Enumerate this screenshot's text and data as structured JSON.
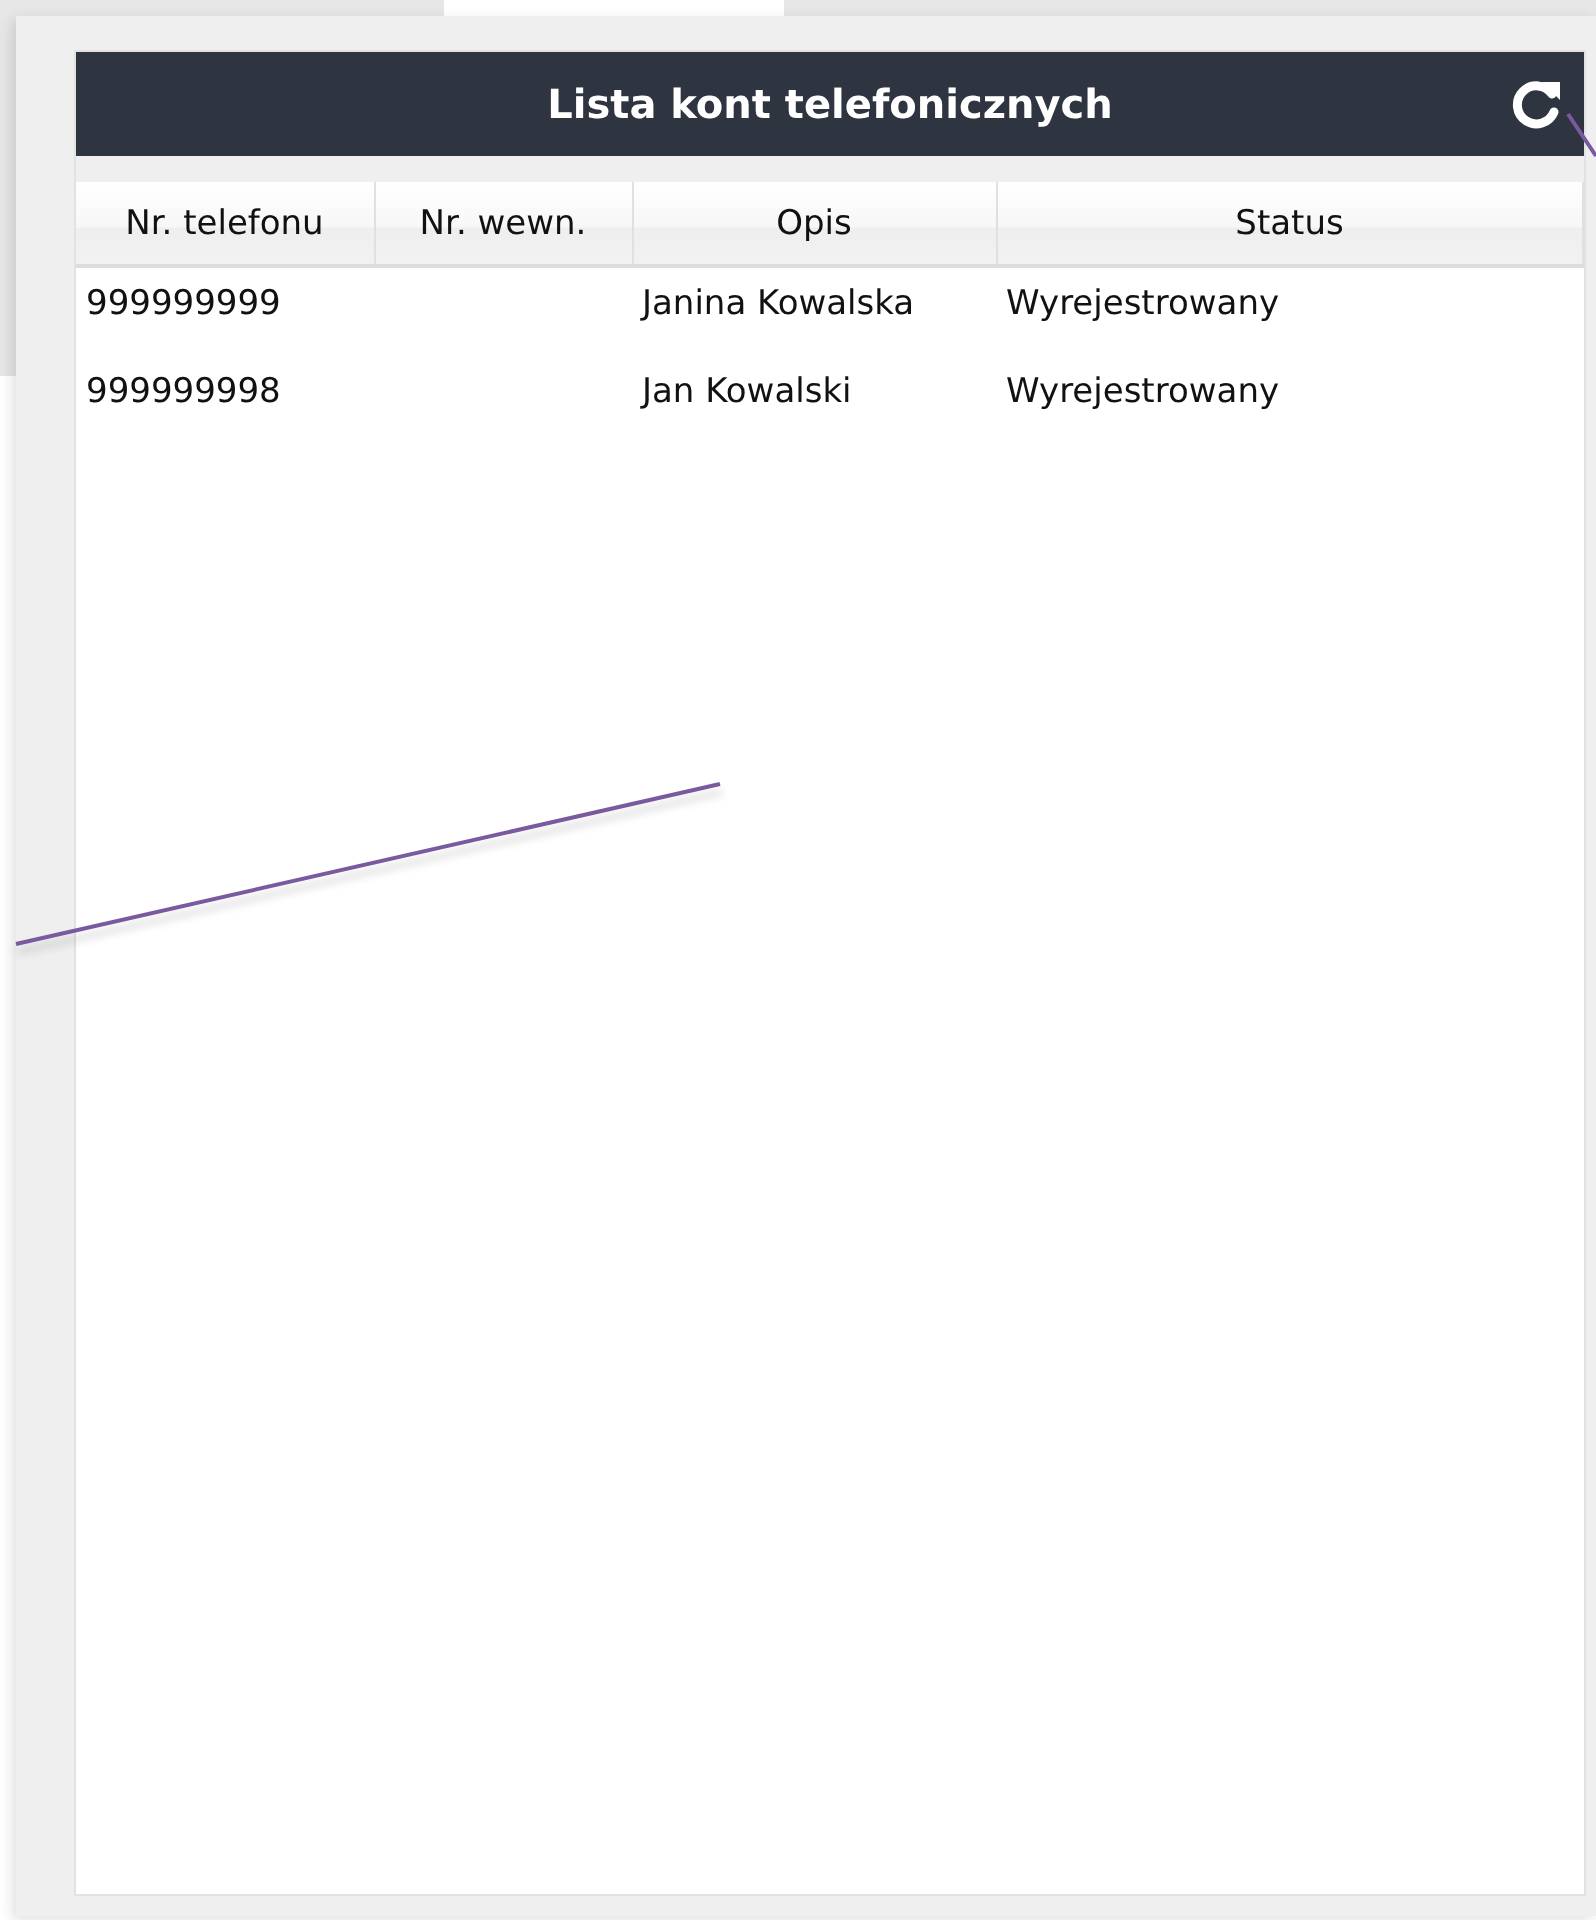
{
  "panel": {
    "title": "Lista kont telefonicznych"
  },
  "table": {
    "columns": [
      "Nr. telefonu",
      "Nr. wewn.",
      "Opis",
      "Status"
    ],
    "rows": [
      {
        "cells": [
          "999999999",
          "",
          "Janina Kowalska",
          "Wyrejestrowany"
        ]
      },
      {
        "cells": [
          "999999998",
          "",
          "Jan Kowalski",
          "Wyrejestrowany"
        ]
      }
    ]
  }
}
